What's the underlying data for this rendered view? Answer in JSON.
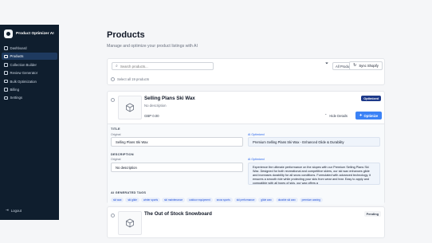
{
  "app": {
    "name": "Product Optimizer AI"
  },
  "sidebar": {
    "items": [
      {
        "label": "Dashboard",
        "icon": "grid-icon"
      },
      {
        "label": "Products",
        "icon": "box-icon",
        "active": true
      },
      {
        "label": "Collection Builder",
        "icon": "layers-icon"
      },
      {
        "label": "Review Generator",
        "icon": "star-icon"
      },
      {
        "label": "Bulk Optimization",
        "icon": "zap-icon"
      },
      {
        "label": "Billing",
        "icon": "card-icon"
      },
      {
        "label": "Settings",
        "icon": "gear-icon"
      }
    ],
    "logout_label": "Logout"
  },
  "header": {
    "title": "Products",
    "subtitle": "Manage and optimize your product listings with AI"
  },
  "toolbar": {
    "search_placeholder": "Search products...",
    "filter_value": "All Products",
    "sync_label": "Sync Shopify",
    "select_all_label": "Select all 19 products"
  },
  "products": [
    {
      "title": "Selling Plans Ski Wax",
      "description": "No description",
      "price": "GBP 0.00",
      "status": "Optimized",
      "hide_label": "Hide Details",
      "optimize_label": "Optimize",
      "details": {
        "title_section": "TITLE",
        "original_label": "Original",
        "ai_label": "AI Optimized",
        "original_title": "Selling Plans Ski Wax",
        "ai_title": "Premium Selling Plans Ski Wax - Enhanced Glide & Durability",
        "description_section": "DESCRIPTION",
        "original_description": "No description",
        "ai_description": "Experience the ultimate performance on the slopes with our Premium Selling Plans Ski Wax. Designed for both recreational and competitive skiers, our ski wax enhances glide and increases durability for all snow conditions. Formulated with advanced technology, it ensures a smooth ride while protecting your skis from wear and tear. Easy to apply and compatible with all types of skis, our wax offers a",
        "tags_section": "AI GENERATED TAGS",
        "tags": [
          "ski wax",
          "ski glide",
          "winter sports",
          "ski maintenance",
          "outdoor equipment",
          "snow sports",
          "ski performance",
          "glide wax",
          "durable ski wax",
          "premium waxing"
        ]
      }
    },
    {
      "title": "The Out of Stock Snowboard",
      "status": "Pending"
    }
  ],
  "colors": {
    "sidebar_bg": "#0f1e2e",
    "accent": "#3b82f6",
    "optimized_badge": "#1e3a8a"
  }
}
